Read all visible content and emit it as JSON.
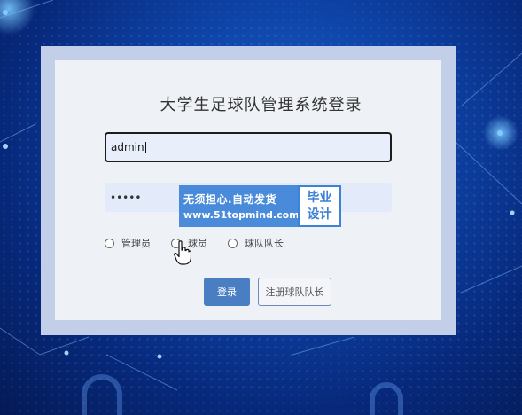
{
  "login": {
    "title": "大学生足球队管理系统登录",
    "username_value": "admin",
    "password_value": "•••••",
    "roles": [
      {
        "label": "管理员",
        "selected": false
      },
      {
        "label": "球员",
        "selected": false
      },
      {
        "label": "球队队长",
        "selected": false
      }
    ],
    "login_label": "登录",
    "register_label": "注册球队队长"
  },
  "watermark": {
    "line1": "无须担心.自动发货",
    "line2": "www.51topmind.com",
    "badge_line1": "毕业",
    "badge_line2": "设计"
  },
  "colors": {
    "background": "#0e44a8",
    "panel": "#eef1f6",
    "frame": "#c3cfe8",
    "primary_button": "#4a7ec3",
    "watermark_blue": "#3c82d7"
  }
}
